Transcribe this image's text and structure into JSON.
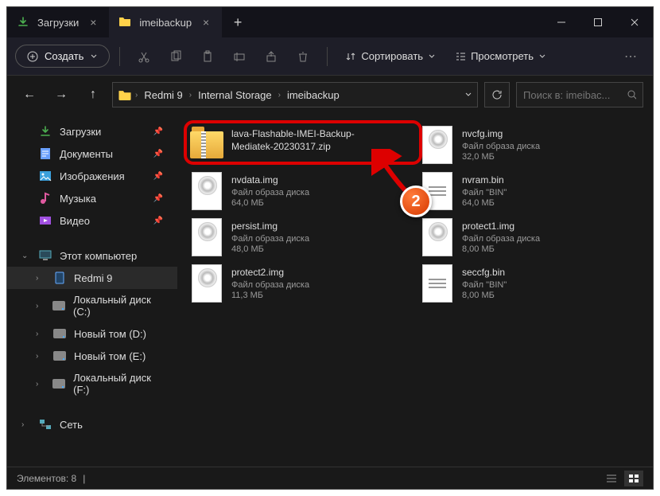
{
  "tabs": [
    {
      "label": "Загрузки",
      "icon": "download"
    },
    {
      "label": "imeibackup",
      "icon": "folder"
    }
  ],
  "toolbar": {
    "create": "Создать",
    "sort": "Сортировать",
    "view": "Просмотреть"
  },
  "breadcrumb": [
    "Redmi 9",
    "Internal Storage",
    "imeibackup"
  ],
  "search_placeholder": "Поиск в: imeibac...",
  "sidebar": {
    "quick": [
      {
        "label": "Загрузки",
        "icon": "download",
        "color": "#4caf50"
      },
      {
        "label": "Документы",
        "icon": "document",
        "color": "#6aa0ff"
      },
      {
        "label": "Изображения",
        "icon": "image",
        "color": "#3aa0dc"
      },
      {
        "label": "Музыка",
        "icon": "music",
        "color": "#e05aa0"
      },
      {
        "label": "Видео",
        "icon": "video",
        "color": "#a050e0"
      }
    ],
    "pc_label": "Этот компьютер",
    "devices": [
      {
        "label": "Redmi 9",
        "icon": "phone",
        "selected": true
      },
      {
        "label": "Локальный диск (C:)",
        "icon": "drive"
      },
      {
        "label": "Новый том (D:)",
        "icon": "drive"
      },
      {
        "label": "Новый том (E:)",
        "icon": "drive"
      },
      {
        "label": "Локальный диск (F:)",
        "icon": "drive"
      }
    ],
    "network_label": "Сеть"
  },
  "files": [
    {
      "name": "lava-Flashable-IMEI-Backup-Mediatek-20230317.zip",
      "type": "zip",
      "meta1": "",
      "meta2": ""
    },
    {
      "name": "nvcfg.img",
      "type": "disc",
      "meta1": "Файл образа диска",
      "meta2": "32,0 МБ"
    },
    {
      "name": "nvdata.img",
      "type": "disc",
      "meta1": "Файл образа диска",
      "meta2": "64,0 МБ"
    },
    {
      "name": "nvram.bin",
      "type": "bin",
      "meta1": "Файл \"BIN\"",
      "meta2": "64,0 МБ"
    },
    {
      "name": "persist.img",
      "type": "disc",
      "meta1": "Файл образа диска",
      "meta2": "48,0 МБ"
    },
    {
      "name": "protect1.img",
      "type": "disc",
      "meta1": "Файл образа диска",
      "meta2": "8,00 МБ"
    },
    {
      "name": "protect2.img",
      "type": "disc",
      "meta1": "Файл образа диска",
      "meta2": "11,3 МБ"
    },
    {
      "name": "seccfg.bin",
      "type": "bin",
      "meta1": "Файл \"BIN\"",
      "meta2": "8,00 МБ"
    }
  ],
  "status": "Элементов: 8",
  "badge": "2"
}
